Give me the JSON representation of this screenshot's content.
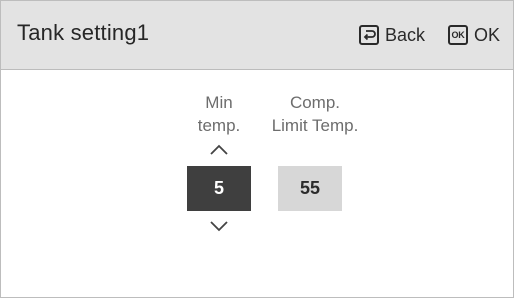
{
  "header": {
    "title": "Tank setting1",
    "back_label": "Back",
    "ok_label": "OK",
    "ok_icon_text": "OK",
    "back_icon": "back-return-icon",
    "ok_icon": "ok-box-icon"
  },
  "settings": {
    "min_temp": {
      "label_line1": "Min",
      "label_line2": "temp.",
      "value": "5"
    },
    "comp_limit": {
      "label_line1": "Comp.",
      "label_line2": "Limit Temp.",
      "value": "55"
    }
  },
  "colors": {
    "header_bg": "#e3e3e3",
    "selected_value_bg": "#3f3f3f",
    "unselected_value_bg": "#d7d7d7",
    "label_text": "#6d6d6d"
  }
}
